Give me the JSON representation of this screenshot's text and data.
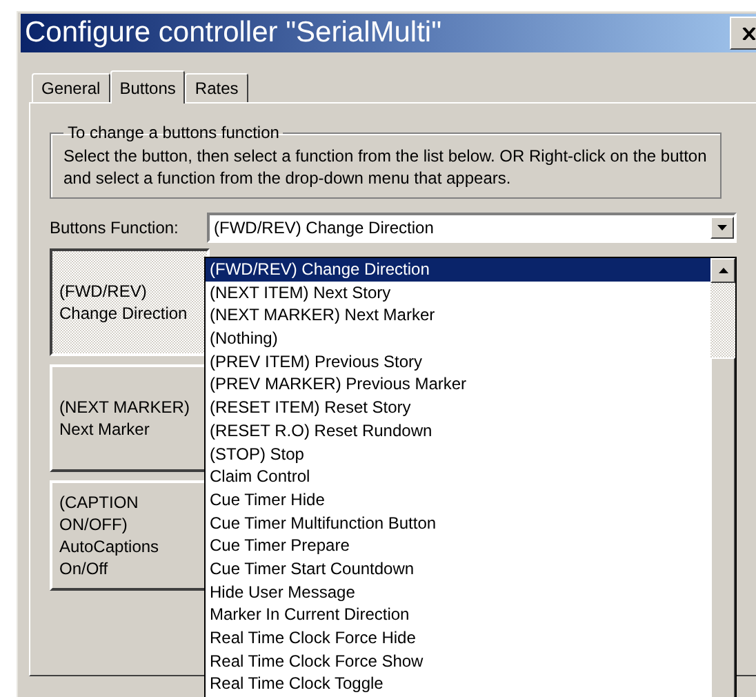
{
  "window": {
    "title": "Configure controller \"SerialMulti\""
  },
  "tabs": [
    {
      "label": "General",
      "selected": false
    },
    {
      "label": "Buttons",
      "selected": true
    },
    {
      "label": "Rates",
      "selected": false
    }
  ],
  "group": {
    "legend": "To change a buttons function",
    "text": "Select the button, then select a function from the list below. OR Right-click on the button and select a function from the drop-down menu that appears."
  },
  "function_field": {
    "label": "Buttons Function:",
    "value": "(FWD/REV) Change Direction"
  },
  "controller_buttons": [
    {
      "lines": [
        "(FWD/REV)",
        "Change Direction"
      ],
      "selected": true
    },
    {
      "lines": [
        "(NEXT MARKER)",
        "Next Marker"
      ],
      "selected": false
    },
    {
      "lines": [
        "(CAPTION",
        "ON/OFF)",
        "AutoCaptions",
        "On/Off"
      ],
      "selected": false
    }
  ],
  "options": [
    {
      "label": "(FWD/REV) Change Direction",
      "selected": true
    },
    {
      "label": "(NEXT ITEM) Next Story",
      "selected": false
    },
    {
      "label": "(NEXT MARKER) Next Marker",
      "selected": false
    },
    {
      "label": "(Nothing)",
      "selected": false
    },
    {
      "label": "(PREV ITEM) Previous Story",
      "selected": false
    },
    {
      "label": "(PREV MARKER) Previous Marker",
      "selected": false
    },
    {
      "label": "(RESET ITEM) Reset Story",
      "selected": false
    },
    {
      "label": "(RESET R.O) Reset Rundown",
      "selected": false
    },
    {
      "label": "(STOP) Stop",
      "selected": false
    },
    {
      "label": "Claim Control",
      "selected": false
    },
    {
      "label": "Cue Timer Hide",
      "selected": false
    },
    {
      "label": "Cue Timer Multifunction Button",
      "selected": false
    },
    {
      "label": "Cue Timer Prepare",
      "selected": false
    },
    {
      "label": "Cue Timer Start Countdown",
      "selected": false
    },
    {
      "label": "Hide User Message",
      "selected": false
    },
    {
      "label": "Marker In Current Direction",
      "selected": false
    },
    {
      "label": "Real Time Clock Force Hide",
      "selected": false
    },
    {
      "label": "Real Time Clock Force Show",
      "selected": false
    },
    {
      "label": "Real Time Clock Toggle",
      "selected": false
    }
  ]
}
